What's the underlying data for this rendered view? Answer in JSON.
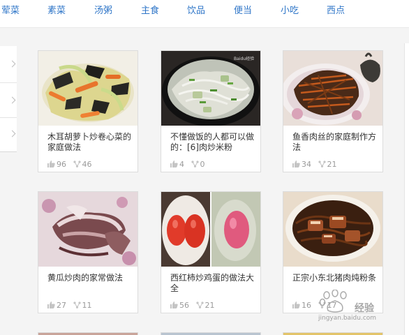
{
  "nav": {
    "items": [
      "荤菜",
      "素菜",
      "汤粥",
      "主食",
      "饮品",
      "便当",
      "小吃",
      "西点"
    ]
  },
  "cards": [
    {
      "title": "木耳胡萝卜炒卷心菜的家庭做法",
      "likes": "96",
      "shares": "46"
    },
    {
      "title": "不懂做饭的人都可以做的：[6]肉炒米粉",
      "likes": "4",
      "shares": "0"
    },
    {
      "title": "鱼香肉丝的家庭制作方法",
      "likes": "34",
      "shares": "21"
    },
    {
      "title": "黄瓜炒肉的家常做法",
      "likes": "27",
      "shares": "11"
    },
    {
      "title": "西红柿炒鸡蛋的做法大全",
      "likes": "56",
      "shares": "21"
    },
    {
      "title": "正宗小东北猪肉炖粉条",
      "likes": "16",
      "shares": "17"
    }
  ],
  "watermark": {
    "photo_mark": "Baidu经验",
    "logo": "经验",
    "url": "jingyan.baidu.com"
  },
  "colors": {
    "nav_link": "#2f76c8",
    "page_bg": "#f4f4f4",
    "card_border": "#dcdcdc",
    "stat_text": "#9a9a9a"
  }
}
